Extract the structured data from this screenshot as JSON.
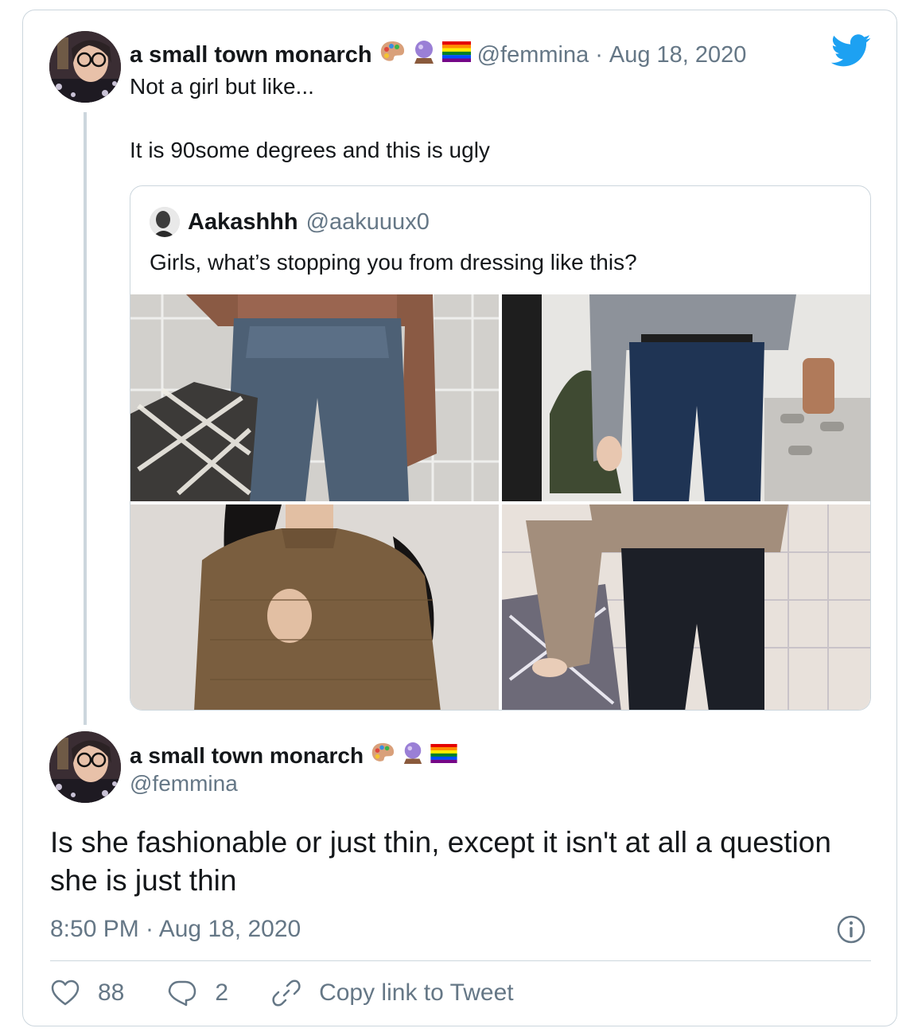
{
  "tweet": {
    "author_name": "a small town monarch",
    "author_emojis": [
      "palette",
      "crystal-ball",
      "rainbow-flag"
    ],
    "handle": "@femmina",
    "separator": "·",
    "date": "Aug 18, 2020",
    "text_line1": "Not a girl but like...",
    "text_line2": "It is 90some degrees and this is ugly"
  },
  "quoted": {
    "author_name": "Aakashhh",
    "handle": "@aakuuux0",
    "text": "Girls, what’s stopping you from dressing like this?",
    "photos": [
      "jeans-brown-top-plaid",
      "blue-jeans-grey-sweater",
      "brown-sweater-long-hair",
      "black-pants-beige-sweater"
    ]
  },
  "reply": {
    "author_name": "a small town monarch",
    "author_emojis": [
      "palette",
      "crystal-ball",
      "rainbow-flag"
    ],
    "handle": "@femmina",
    "text": "Is she fashionable or just thin, except it isn't at all a question she is just thin",
    "time": "8:50 PM · Aug 18, 2020"
  },
  "actions": {
    "likes": "88",
    "replies": "2",
    "copy_link": "Copy link to Tweet"
  },
  "colors": {
    "twitter_blue": "#1da1f2",
    "muted": "#657786",
    "border": "#ccd6dd"
  }
}
